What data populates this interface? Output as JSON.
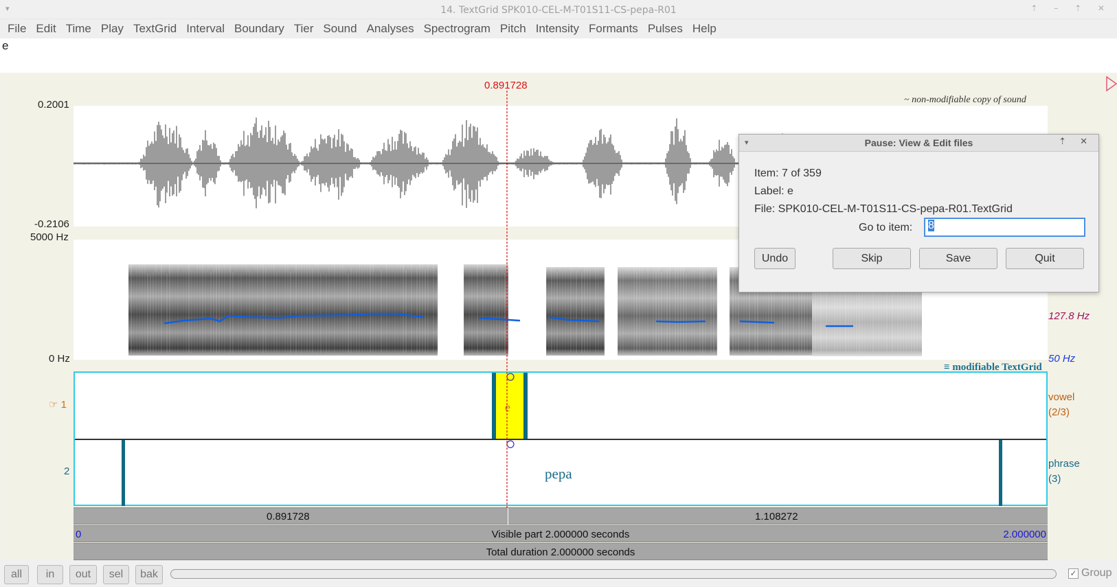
{
  "window": {
    "title": "14. TextGrid SPK010-CEL-M-T01S11-CS-pepa-R01"
  },
  "menu": [
    "File",
    "Edit",
    "Time",
    "Play",
    "TextGrid",
    "Interval",
    "Boundary",
    "Tier",
    "Sound",
    "Analyses",
    "Spectrogram",
    "Pitch",
    "Intensity",
    "Formants",
    "Pulses",
    "Help"
  ],
  "text_field": {
    "value": "e"
  },
  "cursor": {
    "time": "0.891728"
  },
  "sound": {
    "note": "~ non-modifiable copy of sound",
    "ymax": "0.2001",
    "ymin": "-0.2106"
  },
  "spectrogram": {
    "fmax": "5000 Hz",
    "fmin": "0 Hz",
    "pitch_value": "127.8 Hz",
    "pitch_floor": "50 Hz"
  },
  "textgrid": {
    "title": "modifiable TextGrid",
    "tiers": [
      {
        "number": "1",
        "pointer": "☞",
        "name": "vowel",
        "count": "(2/3)",
        "label": "e"
      },
      {
        "number": "2",
        "name": "phrase",
        "count": "(3)",
        "label": "pepa"
      }
    ]
  },
  "time_bars": {
    "left": "0.891728",
    "right": "1.108272",
    "visible_start": "0",
    "visible_label": "Visible part 2.000000 seconds",
    "visible_end": "2.000000",
    "total_label": "Total duration 2.000000 seconds"
  },
  "zoom_buttons": [
    "all",
    "in",
    "out",
    "sel",
    "bak"
  ],
  "group": {
    "label": "Group",
    "checked": true
  },
  "dialog": {
    "title": "Pause: View & Edit files",
    "item_line": "Item: 7 of 359",
    "label_line": "Label: e",
    "file_line": "File: SPK010-CEL-M-T01S11-CS-pepa-R01.TextGrid",
    "goto_label": "Go to item:",
    "goto_value": "8",
    "buttons": {
      "undo": "Undo",
      "skip": "Skip",
      "save": "Save",
      "quit": "Quit"
    }
  },
  "colors": {
    "cursor": "#dd1111",
    "pitch": "#1060e0",
    "textgrid_border": "#2ecbe8",
    "selection": "#ffff00",
    "boundary": "#0e6a82"
  }
}
